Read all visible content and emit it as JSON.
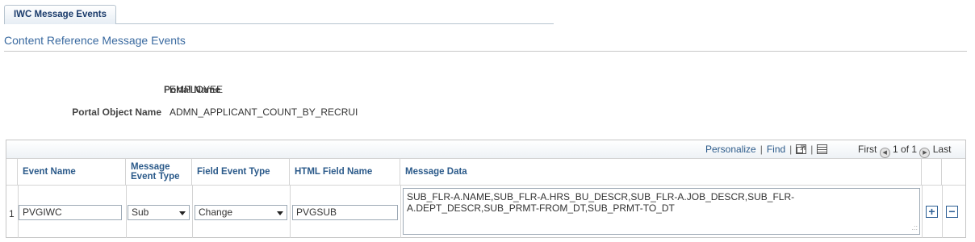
{
  "tab": {
    "label": "IWC Message Events"
  },
  "page": {
    "title": "Content Reference Message Events"
  },
  "fields": {
    "portal_name_label": "Portal Name",
    "portal_name_value": "EMPLOYEE",
    "portal_object_label": "Portal Object Name",
    "portal_object_value": "ADMN_APPLICANT_COUNT_BY_RECRUI"
  },
  "grid": {
    "nav": {
      "personalize": "Personalize",
      "separator": "|",
      "find": "Find",
      "first": "First",
      "range": "1 of 1",
      "last": "Last"
    },
    "columns": {
      "event_name": "Event Name",
      "message_event_type": "Message Event Type",
      "field_event_type": "Field Event Type",
      "html_field_name": "HTML Field Name",
      "message_data": "Message Data"
    },
    "rows": [
      {
        "num": "1",
        "event_name": "PVGIWC",
        "message_event_type": "Sub",
        "field_event_type": "Change",
        "html_field_name": "PVGSUB",
        "message_data": "SUB_FLR-A.NAME,SUB_FLR-A.HRS_BU_DESCR,SUB_FLR-A.JOB_DESCR,SUB_FLR-A.DEPT_DESCR,SUB_PRMT-FROM_DT,SUB_PRMT-TO_DT",
        "message_data_line1": "SUB_FLR-A.NAME,SUB_FLR-A.HRS_BU_DESCR,SUB_FLR-A.JOB_DESCR,SUB_FLR-",
        "message_data_line2": "A.DEPT_DESCR,SUB_PRMT-FROM_DT,SUB_PRMT-TO_DT"
      }
    ],
    "add_label": "+",
    "delete_label": "−"
  },
  "icons": {
    "view_all": "view-all-icon",
    "download": "download-grid-icon",
    "first": "first-arrow-icon",
    "last": "last-arrow-icon"
  }
}
